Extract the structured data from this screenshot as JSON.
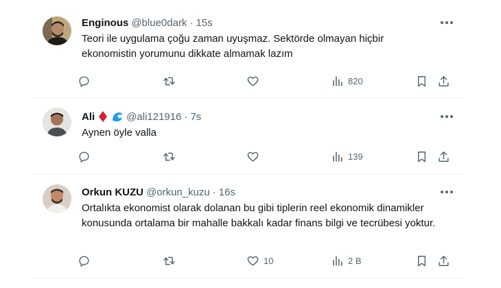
{
  "tweets": [
    {
      "name": "Enginous",
      "handle": "@blue0dark",
      "separator": "·",
      "time": "15s",
      "text": "Teori ile uygulama çoğu zaman uyuşmaz. Sektörde olmayan hiçbir ekonomistin yorumunu dikkate almamak lazım",
      "replies": "",
      "retweets": "",
      "likes": "",
      "views": "820"
    },
    {
      "name": "Ali",
      "handle": "@ali121916",
      "separator": "·",
      "time": "7s",
      "text": "Aynen öyle valla",
      "replies": "",
      "retweets": "",
      "likes": "",
      "views": "139"
    },
    {
      "name": "Orkun KUZU",
      "handle": "@orkun_kuzu",
      "separator": "·",
      "time": "16s",
      "text": "Ortalıkta ekonomist olarak dolanan bu gibi tiplerin reel ekonomik dinamikler konusunda ortalama bir mahalle bakkalı kadar finans bilgi ve tecrübesi yoktur.",
      "replies": "",
      "retweets": "",
      "likes": "10",
      "views": "2 B"
    }
  ],
  "colors": {
    "text": "#0f1419",
    "secondary": "#536471",
    "divider": "#eff3f4",
    "badge_red": "#d6212e",
    "badge_blue": "#1d9bf0"
  },
  "icons": [
    "reply-icon",
    "retweet-icon",
    "like-icon",
    "views-icon",
    "bookmark-icon",
    "share-icon",
    "more-icon",
    "diamond-icon",
    "wave-icon"
  ]
}
